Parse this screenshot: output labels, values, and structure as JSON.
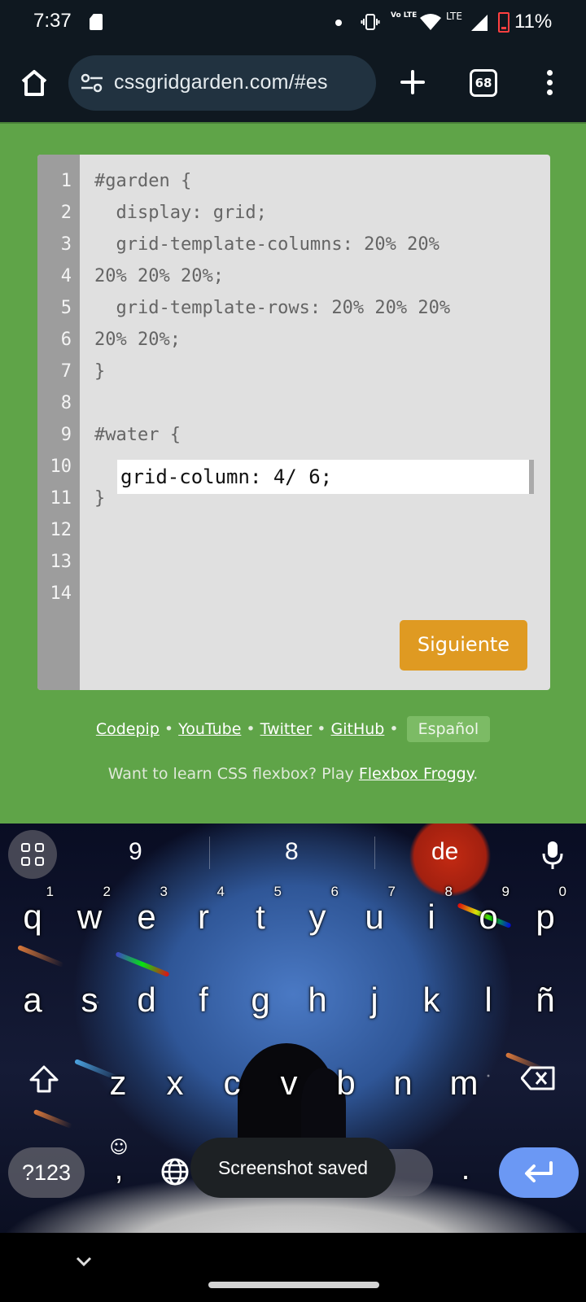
{
  "status_bar": {
    "time": "7:37",
    "volte": "Vo LTE",
    "lte": "LTE",
    "battery": "11%",
    "icons": [
      "sd-card-icon",
      "dot-icon",
      "vibrate-icon",
      "volte-icon",
      "wifi-icon",
      "signal-icon",
      "battery-low-icon"
    ]
  },
  "browser": {
    "url": "cssgridgarden.com/#es",
    "tab_count": "68",
    "icons": [
      "home-icon",
      "site-settings-icon",
      "new-tab-icon",
      "tabs-icon",
      "menu-icon"
    ]
  },
  "editor": {
    "line_numbers": [
      "1",
      "2",
      "3",
      "4",
      "5",
      "6",
      "7",
      "8",
      "9",
      "10",
      "11",
      "12",
      "13",
      "14"
    ],
    "lines": [
      "#garden {",
      "  display: grid;",
      "  grid-template-columns: 20% 20%",
      "20% 20% 20%;",
      "  grid-template-rows: 20% 20% 20%",
      "20% 20%;",
      "}",
      "",
      "#water {",
      "",
      "}",
      "",
      "",
      ""
    ],
    "answer_value": "grid-column: 4/ 6;",
    "next_button": "Siguiente"
  },
  "footer": {
    "links": [
      "Codepip",
      "YouTube",
      "Twitter",
      "GitHub"
    ],
    "separator": "•",
    "language": "Español",
    "promo_text": "Want to learn CSS flexbox? Play ",
    "promo_link": "Flexbox Froggy",
    "promo_end": "."
  },
  "keyboard": {
    "suggestions": [
      "9",
      "8",
      "de"
    ],
    "row1": [
      "q",
      "w",
      "e",
      "r",
      "t",
      "y",
      "u",
      "i",
      "o",
      "p"
    ],
    "row1_hints": [
      "1",
      "2",
      "3",
      "4",
      "5",
      "6",
      "7",
      "8",
      "9",
      "0"
    ],
    "row2": [
      "a",
      "s",
      "d",
      "f",
      "g",
      "h",
      "j",
      "k",
      "l",
      "ñ"
    ],
    "row3": [
      "z",
      "x",
      "c",
      "v",
      "b",
      "n",
      "m"
    ],
    "num_key": "?123",
    "comma_key": ",",
    "period_key": ".",
    "accent_color": "#6b98f4"
  },
  "toast": "Screenshot saved",
  "colors": {
    "page_bg": "#5fa448",
    "button": "#df9a22",
    "browser_bg": "#0f1820"
  }
}
